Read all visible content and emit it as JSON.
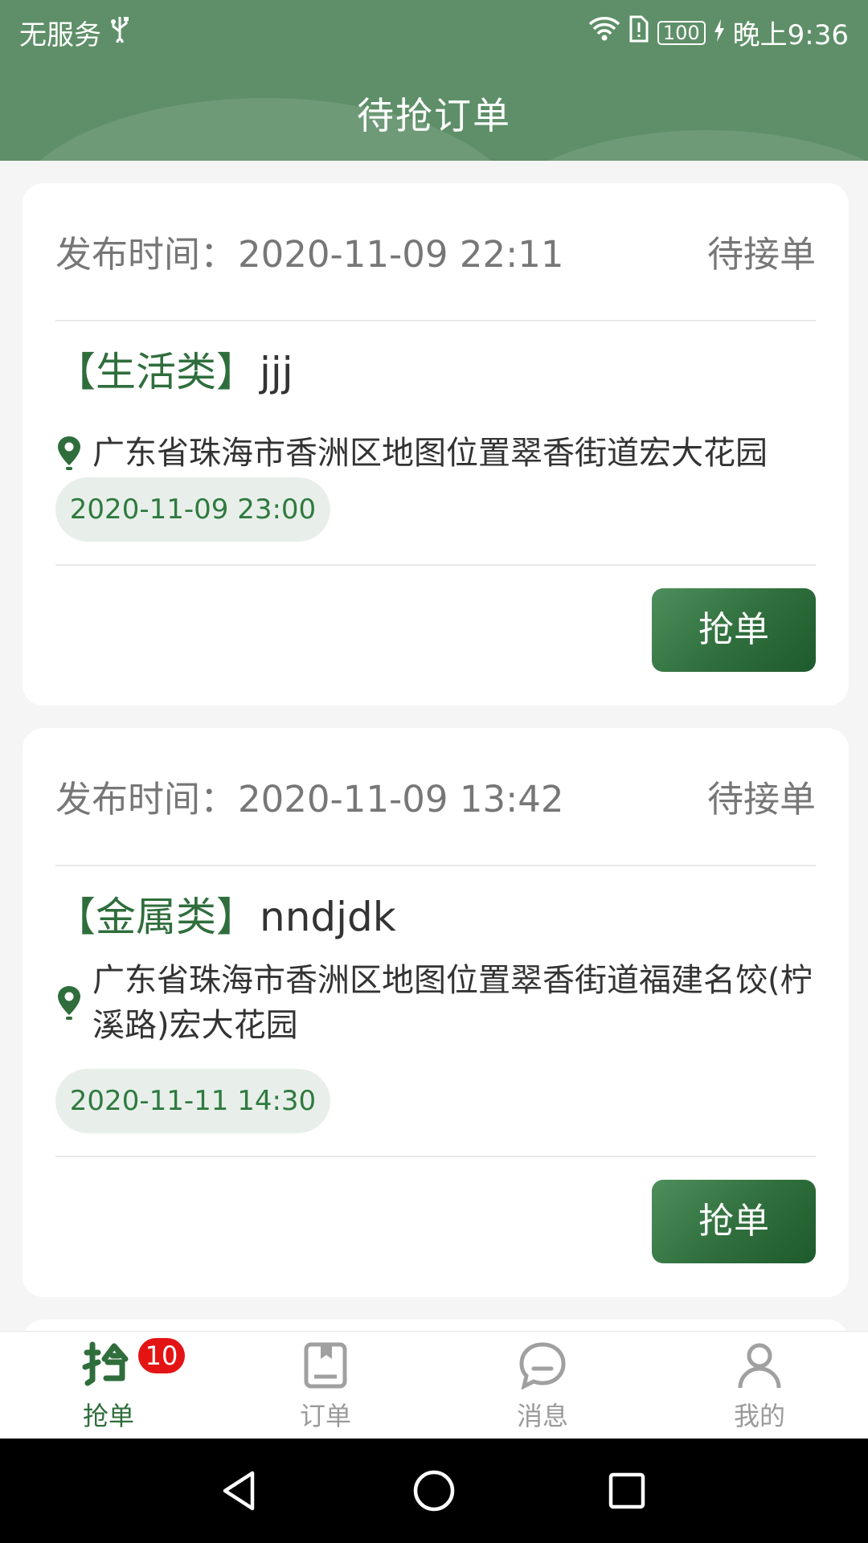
{
  "status_bar": {
    "carrier": "无服务",
    "battery": "100",
    "time": "晚上9:36"
  },
  "header": {
    "title": "待抢订单"
  },
  "orders": [
    {
      "publish_label": "发布时间：",
      "publish_time": "2020-11-09 22:11",
      "status": "待接单",
      "category": "【生活类】",
      "name": "jjj",
      "address": "广东省珠海市香洲区地图位置翠香街道宏大花园",
      "service_time": "2020-11-09 23:00",
      "action_label": "抢单"
    },
    {
      "publish_label": "发布时间：",
      "publish_time": "2020-11-09 13:42",
      "status": "待接单",
      "category": "【金属类】",
      "name": "nndjdk",
      "address": "广东省珠海市香洲区地图位置翠香街道福建名饺(柠溪路)宏大花园",
      "service_time": "2020-11-11 14:30",
      "action_label": "抢单"
    }
  ],
  "bottom_nav": {
    "items": [
      {
        "label": "抢单",
        "icon": "grab-icon",
        "active": true,
        "badge": "10"
      },
      {
        "label": "订单",
        "icon": "order-book-icon",
        "active": false
      },
      {
        "label": "消息",
        "icon": "message-bubble-icon",
        "active": false
      },
      {
        "label": "我的",
        "icon": "person-icon",
        "active": false
      }
    ]
  },
  "colors": {
    "header_green": "#5e8f68",
    "accent_green": "#2f6e3c",
    "badge_red": "#e41414",
    "pill_bg": "#e8efea"
  }
}
